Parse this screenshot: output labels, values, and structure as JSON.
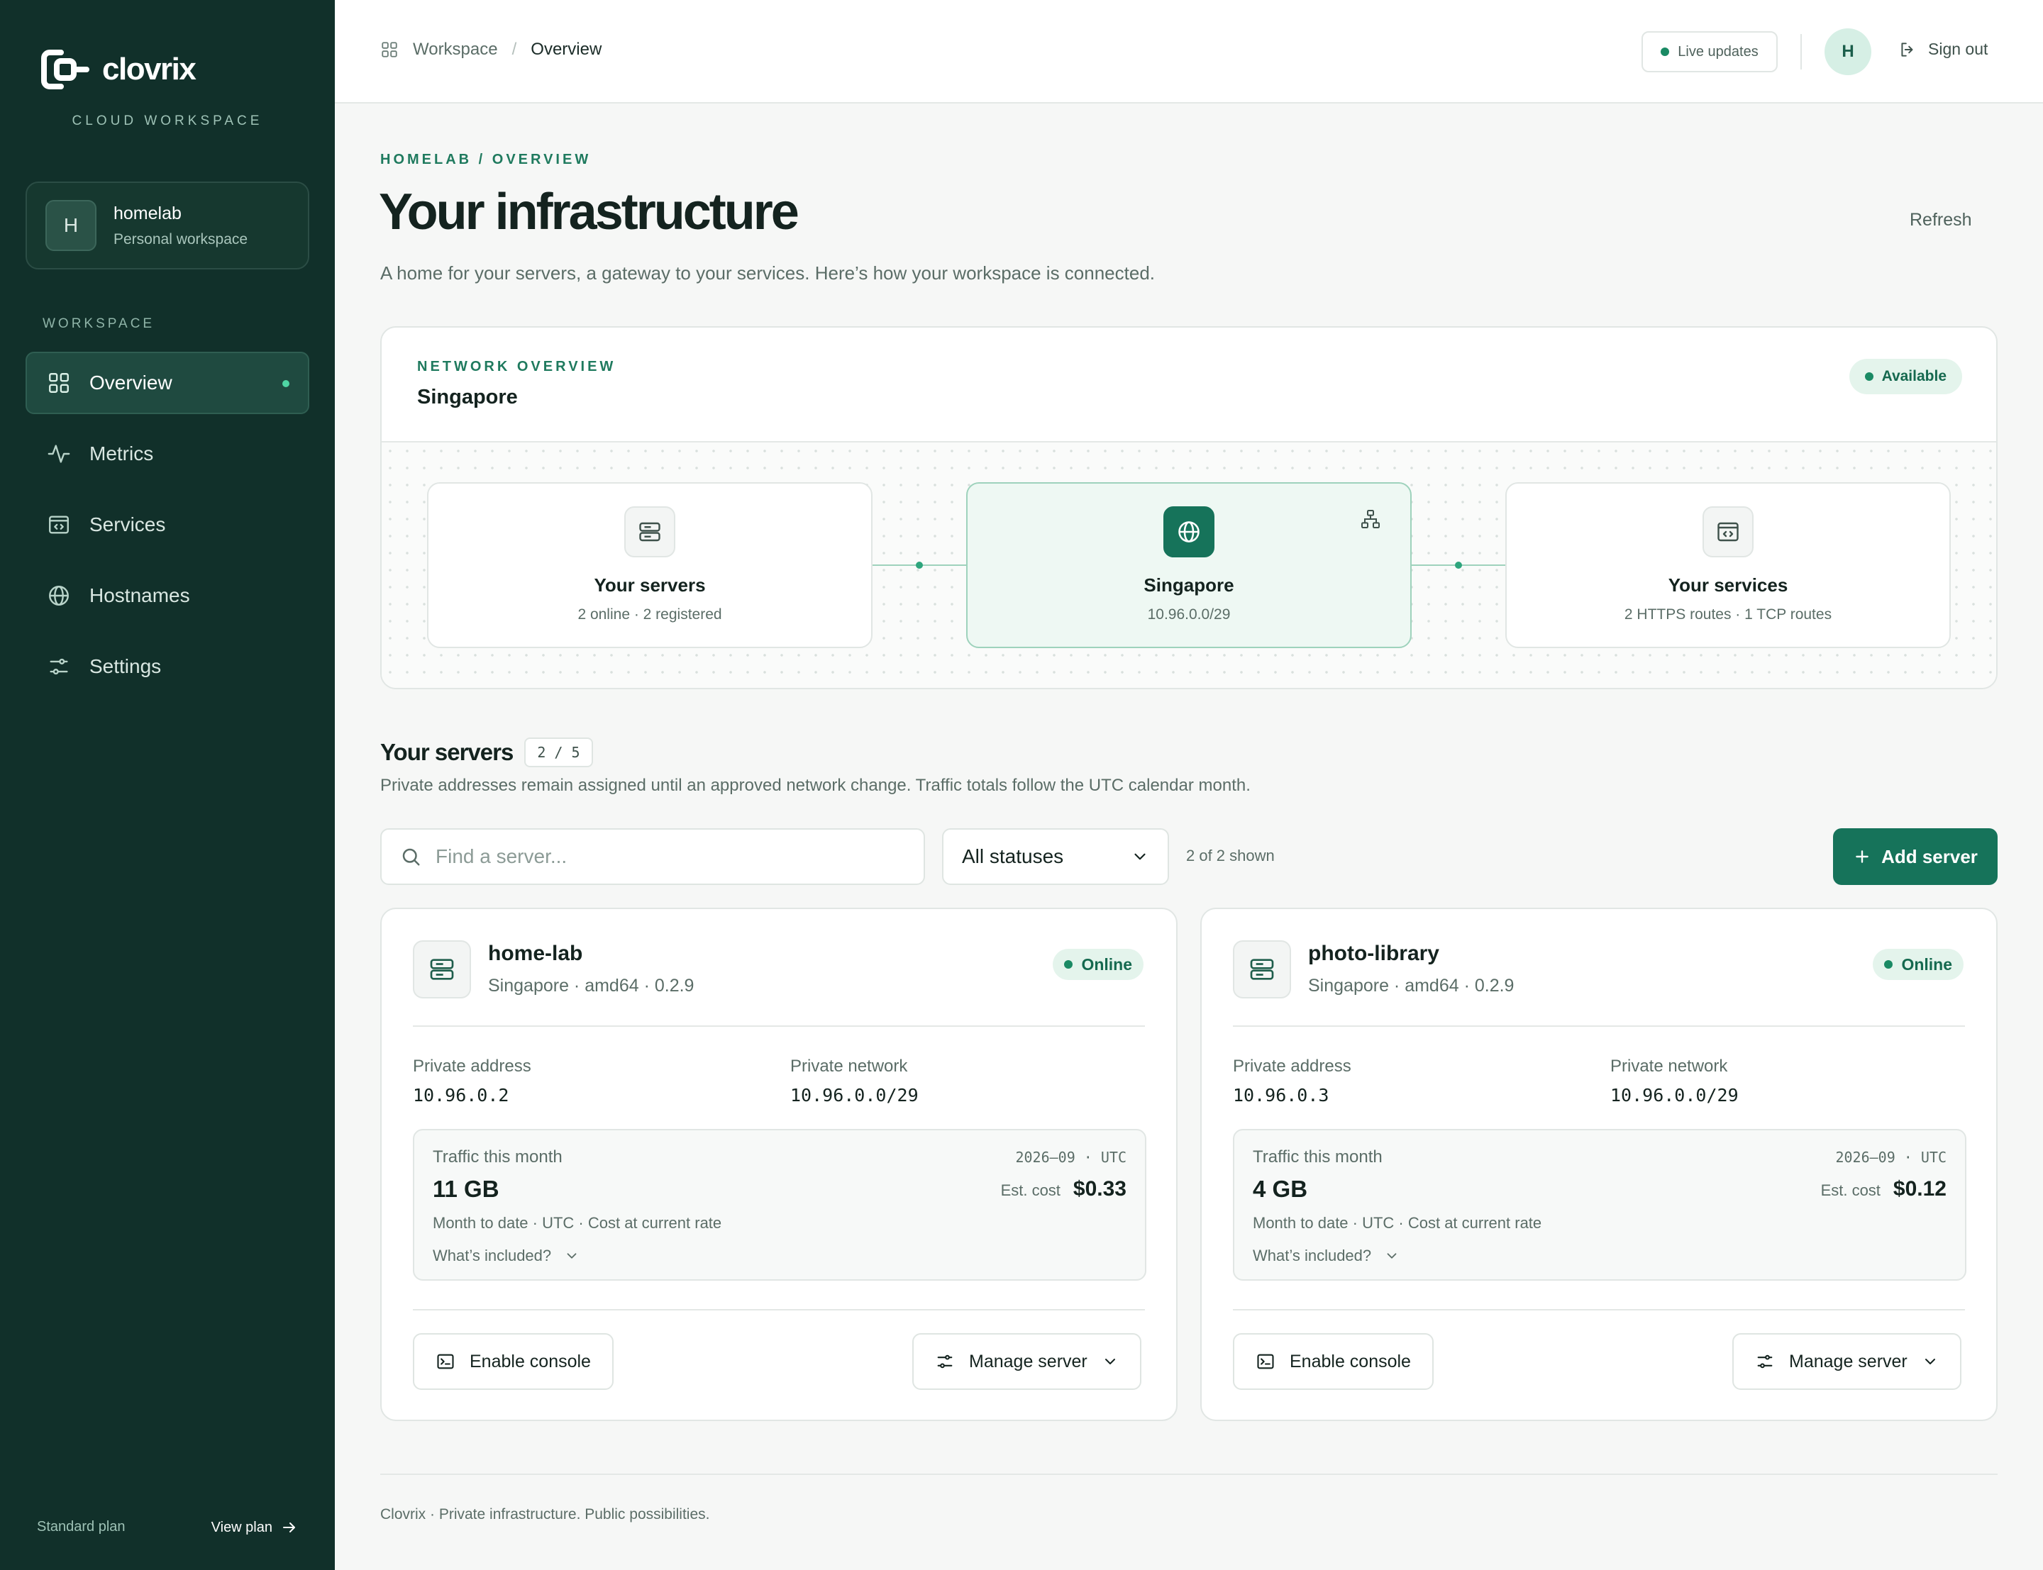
{
  "brand": {
    "name": "clovrix",
    "tagline": "CLOUD WORKSPACE"
  },
  "workspace": {
    "initial": "H",
    "name": "homelab",
    "kind": "Personal workspace"
  },
  "nav": {
    "section_label": "WORKSPACE",
    "items": [
      {
        "label": "Overview",
        "icon": "grid-icon",
        "active": true
      },
      {
        "label": "Metrics",
        "icon": "activity-icon"
      },
      {
        "label": "Services",
        "icon": "browser-code-icon"
      },
      {
        "label": "Hostnames",
        "icon": "globe-icon"
      },
      {
        "label": "Settings",
        "icon": "sliders-icon"
      }
    ]
  },
  "sidebar_footer": {
    "plan": "Standard plan",
    "view_plan": "View plan"
  },
  "topbar": {
    "breadcrumb": [
      "Workspace",
      "Overview"
    ],
    "breadcrumb_sep": "/",
    "live": "Live updates",
    "avatar_initial": "H",
    "sign_out": "Sign out"
  },
  "page": {
    "eyebrow": "HOMELAB / OVERVIEW",
    "title": "Your infrastructure",
    "refresh": "Refresh",
    "description": "A home for your servers, a gateway to your services. Here’s how your workspace is connected."
  },
  "network": {
    "eyebrow": "NETWORK OVERVIEW",
    "region": "Singapore",
    "status": "Available",
    "nodes": [
      {
        "name": "Your servers",
        "sub": "2 online · 2 registered",
        "icon": "server-icon"
      },
      {
        "name": "Singapore",
        "sub": "10.96.0.0/29",
        "icon": "globe-icon"
      },
      {
        "name": "Your services",
        "sub": "2 HTTPS routes · 1 TCP routes",
        "icon": "browser-code-icon"
      }
    ]
  },
  "servers_section": {
    "title": "Your servers",
    "count": "2 / 5",
    "description": "Private addresses remain assigned until an approved network change. Traffic totals follow the UTC calendar month.",
    "search_placeholder": "Find a server...",
    "status_filter": "All statuses",
    "shown": "2 of 2 shown",
    "add_button": "Add server"
  },
  "servers": [
    {
      "name": "home-lab",
      "meta": "Singapore · amd64 · 0.2.9",
      "status": "Online",
      "private_address_label": "Private address",
      "private_address": "10.96.0.2",
      "private_network_label": "Private network",
      "private_network": "10.96.0.0/29",
      "traffic_label": "Traffic this month",
      "period": "2026–09 · UTC",
      "traffic": "11 GB",
      "cost_label": "Est. cost",
      "cost": "$0.33",
      "traffic_note": "Month to date · UTC · Cost at current rate",
      "included": "What’s included?",
      "console_button": "Enable console",
      "manage_button": "Manage server"
    },
    {
      "name": "photo-library",
      "meta": "Singapore · amd64 · 0.2.9",
      "status": "Online",
      "private_address_label": "Private address",
      "private_address": "10.96.0.3",
      "private_network_label": "Private network",
      "private_network": "10.96.0.0/29",
      "traffic_label": "Traffic this month",
      "period": "2026–09 · UTC",
      "traffic": "4 GB",
      "cost_label": "Est. cost",
      "cost": "$0.12",
      "traffic_note": "Month to date · UTC · Cost at current rate",
      "included": "What’s included?",
      "console_button": "Enable console",
      "manage_button": "Manage server"
    }
  ],
  "footer": {
    "text": "Clovrix · Private infrastructure. Public possibilities."
  },
  "colors": {
    "sidebar": "#11302a",
    "accent": "#16735a",
    "online": "#1a8a64",
    "background": "#f6f7f6"
  }
}
